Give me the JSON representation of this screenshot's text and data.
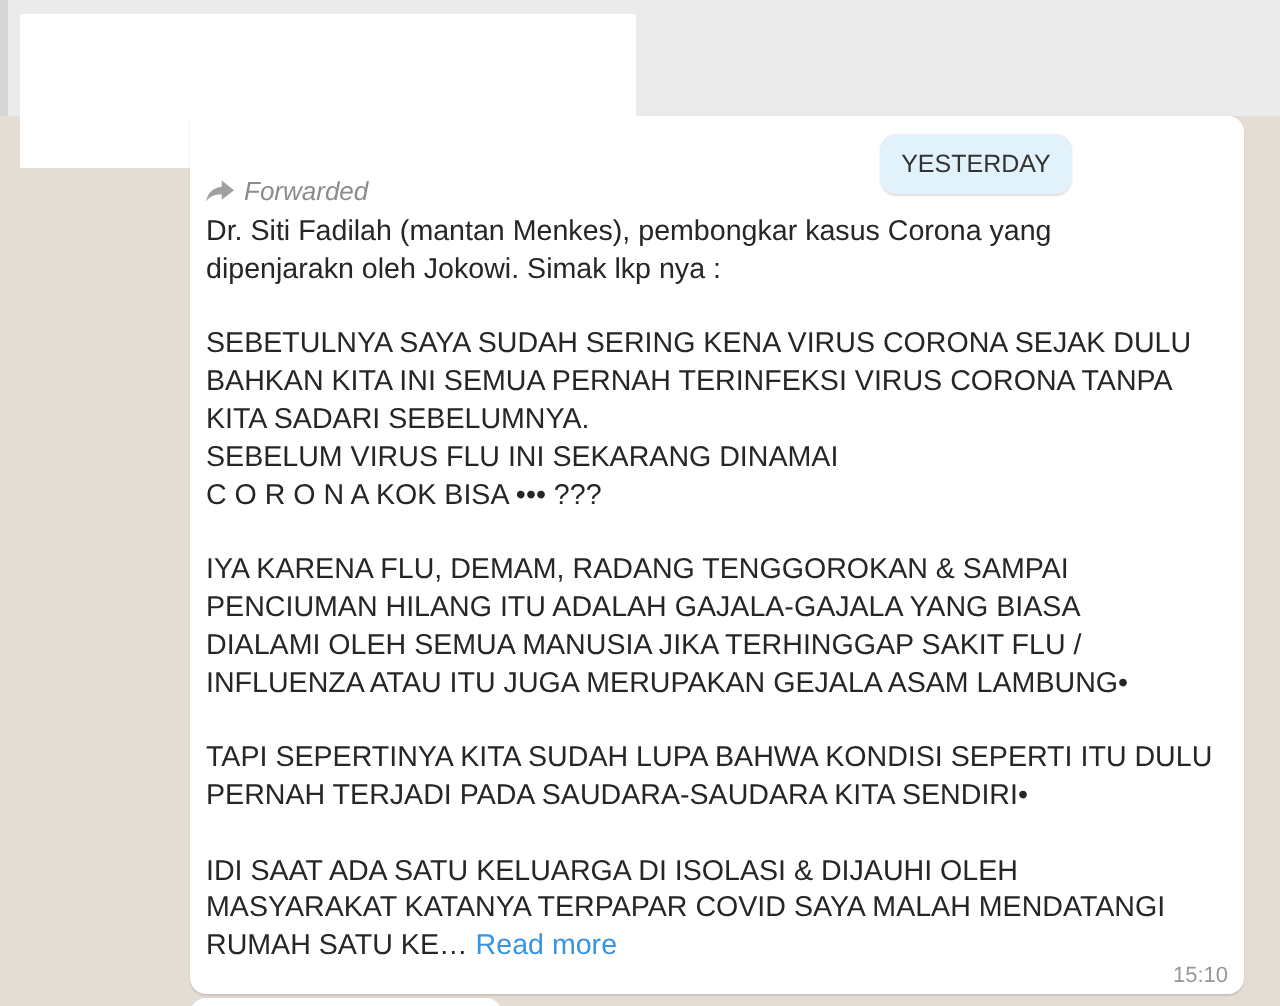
{
  "date_pill": "YESTERDAY",
  "message": {
    "forwarded": "Forwarded",
    "text": "Dr. Siti Fadilah (mantan Menkes), pembongkar kasus Corona yang\ndipenjarakn oleh Jokowi. Simak lkp nya :\n\nSEBETULNYA SAYA SUDAH SERING KENA VIRUS CORONA SEJAK DULU\nBAHKAN KITA INI SEMUA PERNAH TERINFEKSI VIRUS CORONA TANPA\nKITA SADARI SEBELUMNYA.\nSEBELUM VIRUS FLU INI SEKARANG DINAMAI\nC O R O N A KOK BISA ••• ???\n\nIYA KARENA FLU, DEMAM, RADANG TENGGOROKAN & SAMPAI\nPENCIUMAN HILANG ITU ADALAH GAJALA-GAJALA YANG BIASA\nDIALAMI OLEH SEMUA MANUSIA JIKA TERHINGGAP SAKIT FLU /\nINFLUENZA ATAU ITU JUGA MERUPAKAN GEJALA ASAM LAMBUNG•\n\nTAPI SEPERTINYA KITA SUDAH LUPA BAHWA KONDISI SEPERTI ITU DULU\nPERNAH TERJADI PADA SAUDARA-SAUDARA KITA SENDIRI•\n\nIDI SAAT ADA SATU KELUARGA DI ISOLASI & DIJAUHI OLEH\nMASYARAKAT KATANYA TERPAPAR COVID SAYA MALAH MENDATANGI\nRUMAH SATU KE…",
    "read_more": "Read more",
    "time": "15:10"
  }
}
